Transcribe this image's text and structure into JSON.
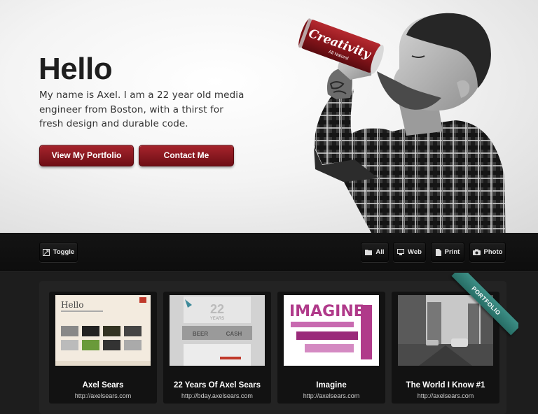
{
  "hero": {
    "title": "Hello",
    "intro": "My name is Axel. I am a 22 year old media engineer from Boston, with a thirst for fresh design and durable code.",
    "portfolio_button": "View My Portfolio",
    "contact_button": "Contact Me",
    "can_text": "Creativity",
    "can_subtext": "All Natural"
  },
  "filters": {
    "toggle": "Toggle",
    "all": "All",
    "web": "Web",
    "print": "Print",
    "photo": "Photo"
  },
  "portfolio": {
    "ribbon": "PORTFOLIO",
    "items": [
      {
        "title": "Axel Sears",
        "url": "http://axelsears.com",
        "thumb_text": "Hello"
      },
      {
        "title": "22 Years Of Axel Sears",
        "url": "http://bday.axelsears.com",
        "thumb_text": "22",
        "thumb_sub": "YEARS",
        "thumb_a": "BEER",
        "thumb_b": "CASH"
      },
      {
        "title": "Imagine",
        "url": "http://axelsears.com",
        "thumb_text": "IMAGINE"
      },
      {
        "title": "The World I Know #1",
        "url": "http://axelsears.com"
      }
    ]
  },
  "colors": {
    "accent_red": "#8c1a22",
    "ribbon_teal": "#2f7d74",
    "dark_bg": "#1d1d1d"
  }
}
